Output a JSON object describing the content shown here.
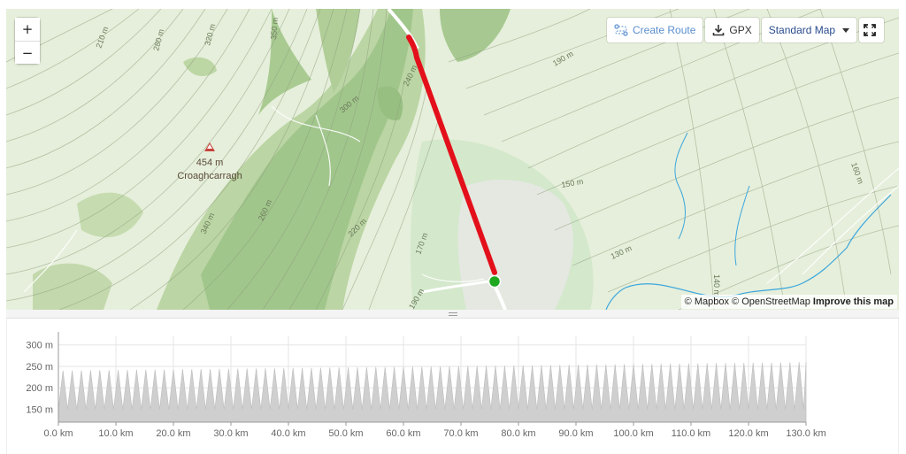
{
  "map": {
    "zoom_in_label": "+",
    "zoom_out_label": "−",
    "toolbar": {
      "create_route_label": "Create Route",
      "gpx_label": "GPX",
      "map_style_label": "Standard Map"
    },
    "peak": {
      "elevation": "454 m",
      "name": "Croaghcarragh"
    },
    "contour_labels": [
      "210 m",
      "280 m",
      "320 m",
      "350 m",
      "300 m",
      "240 m",
      "190 m",
      "160 m",
      "150 m",
      "130 m",
      "140 m",
      "170 m",
      "220 m",
      "260 m",
      "340 m",
      "190 m"
    ],
    "attribution": {
      "mapbox": "© Mapbox",
      "osm": "© OpenStreetMap",
      "improve": "Improve this map"
    },
    "colors": {
      "route": "#e3101b",
      "start_marker": "#1fa81f",
      "water": "#3aa6dd",
      "contour": "#8c9c7a"
    }
  },
  "elevation_profile": {
    "y_ticks": [
      "300 m",
      "250 m",
      "200 m",
      "150 m"
    ],
    "x_ticks": [
      "0.0 km",
      "10.0 km",
      "20.0 km",
      "30.0 km",
      "40.0 km",
      "50.0 km",
      "60.0 km",
      "70.0 km",
      "80.0 km",
      "90.0 km",
      "100.0 km",
      "110.0 km",
      "120.0 km",
      "130.0 km"
    ]
  },
  "chart_data": {
    "type": "area",
    "title": "",
    "xlabel": "",
    "ylabel": "",
    "xlim": [
      0,
      130
    ],
    "ylim": [
      120,
      320
    ],
    "x_unit": "km",
    "y_unit": "m",
    "grid": true,
    "series": [
      {
        "values_pattern": "sawtooth",
        "period_km": 1.6,
        "low_m": 150,
        "high_start_m": 240,
        "high_end_m": 260
      }
    ]
  }
}
